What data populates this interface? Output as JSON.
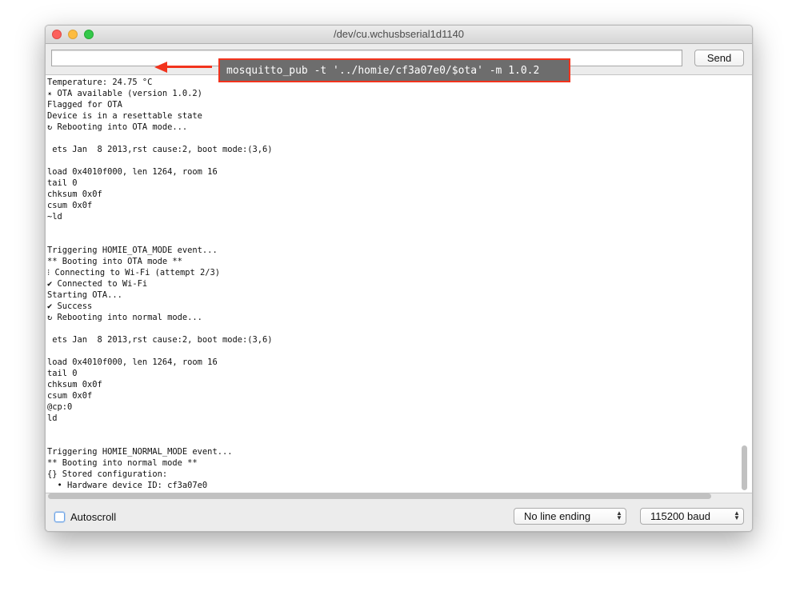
{
  "window": {
    "title": "/dev/cu.wchusbserial1d1140"
  },
  "input": {
    "value": "",
    "placeholder": ""
  },
  "send_label": "Send",
  "console_lines": [
    "Temperature: 24.75 °C",
    "✴ OTA available (version 1.0.2)",
    "Flagged for OTA",
    "Device is in a resettable state",
    "↻ Rebooting into OTA mode...",
    "",
    " ets Jan  8 2013,rst cause:2, boot mode:(3,6)",
    "",
    "load 0x4010f000, len 1264, room 16",
    "tail 0",
    "chksum 0x0f",
    "csum 0x0f",
    "~ld",
    "",
    "",
    "Triggering HOMIE_OTA_MODE event...",
    "** Booting into OTA mode **",
    "⁝ Connecting to Wi-Fi (attempt 2/3)",
    "✔ Connected to Wi-Fi",
    "Starting OTA...",
    "✔ Success",
    "↻ Rebooting into normal mode...",
    "",
    " ets Jan  8 2013,rst cause:2, boot mode:(3,6)",
    "",
    "load 0x4010f000, len 1264, room 16",
    "tail 0",
    "chksum 0x0f",
    "csum 0x0f",
    "@cp:0",
    "ld",
    "",
    "",
    "Triggering HOMIE_NORMAL_MODE event...",
    "** Booting into normal mode **",
    "{} Stored configuration:",
    "  • Hardware device ID: cf3a07e0"
  ],
  "annotation": {
    "command": "mosquitto_pub -t '../homie/cf3a07e0/$ota' -m 1.0.2"
  },
  "autoscroll": {
    "label": "Autoscroll",
    "checked": false
  },
  "line_ending": {
    "selected": "No line ending"
  },
  "baud": {
    "selected": "115200 baud"
  },
  "colors": {
    "annotation_border": "#f2331d",
    "annotation_fill": "#6d6d6d",
    "close": "#fc605c",
    "minimize": "#fdbc40",
    "maximize": "#34c84a"
  }
}
